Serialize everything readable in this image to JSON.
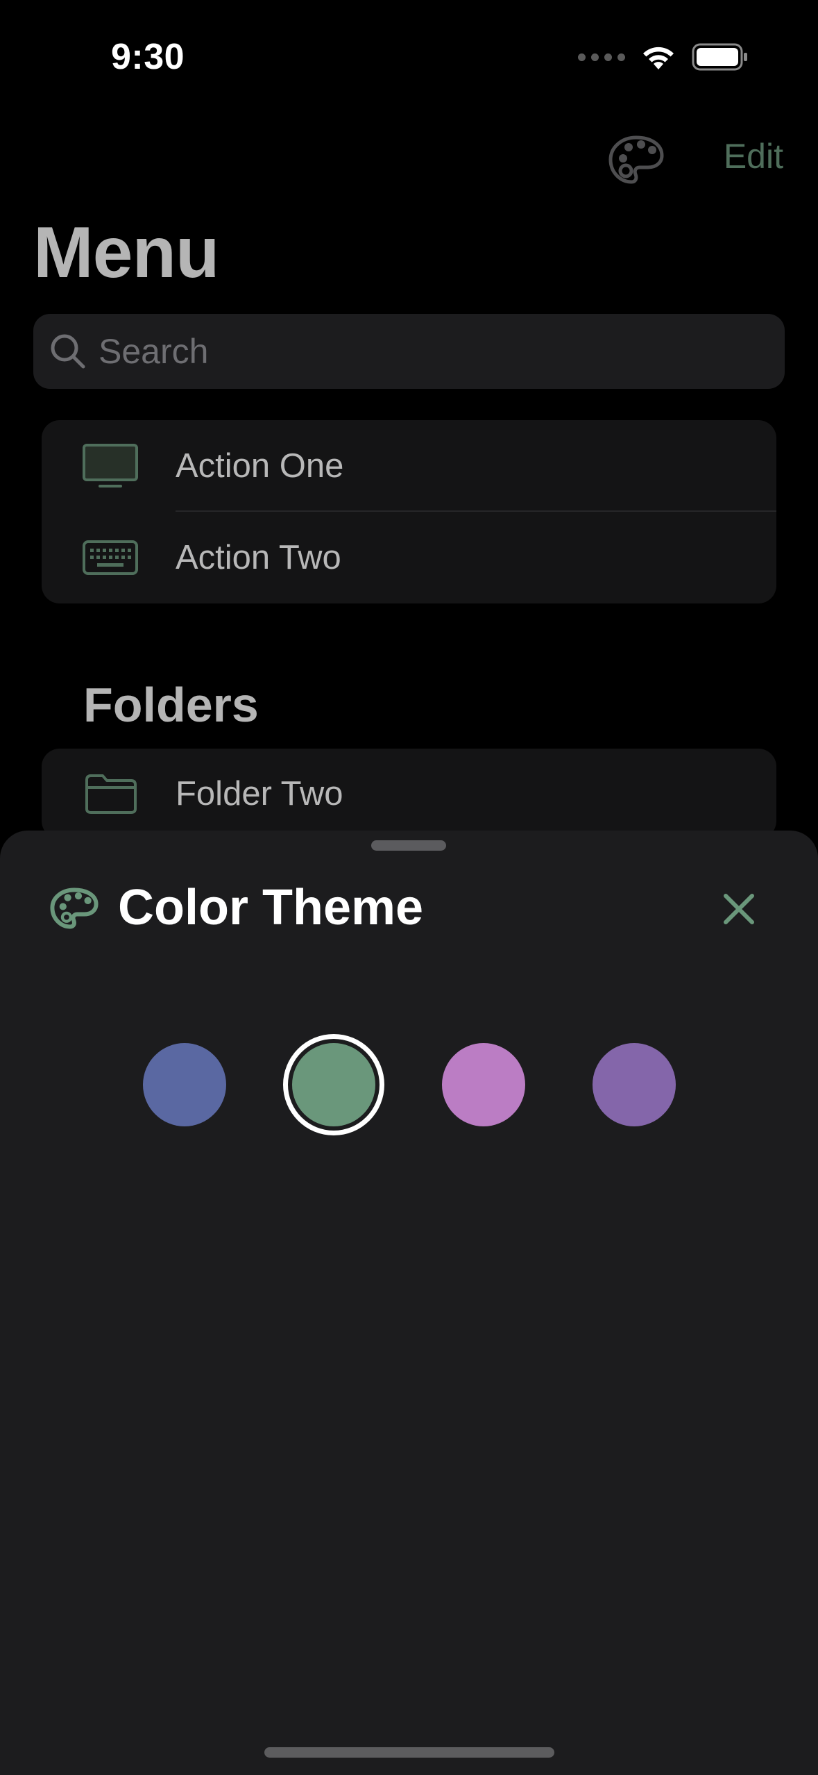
{
  "status_bar": {
    "time": "9:30"
  },
  "nav": {
    "edit_label": "Edit",
    "palette_icon": "palette-icon"
  },
  "title": "Menu",
  "search": {
    "placeholder": "Search"
  },
  "actions": [
    {
      "label": "Action One",
      "icon": "display-icon"
    },
    {
      "label": "Action Two",
      "icon": "keyboard-icon"
    }
  ],
  "folders": {
    "header": "Folders",
    "items": [
      {
        "label": "Folder Two",
        "icon": "folder-icon"
      }
    ]
  },
  "sheet": {
    "title": "Color Theme",
    "icon": "palette-icon",
    "close_icon": "close-icon",
    "swatches": [
      {
        "name": "blue",
        "color": "#5a68a2",
        "selected": false
      },
      {
        "name": "green",
        "color": "#6a977b",
        "selected": true
      },
      {
        "name": "pink",
        "color": "#bb7dc4",
        "selected": false
      },
      {
        "name": "purple",
        "color": "#8466aa",
        "selected": false
      }
    ]
  },
  "colors": {
    "accent": "#6a977b",
    "accent_dim": "#4f6e5b",
    "background": "#000000",
    "sheet_background": "#1c1c1e"
  }
}
